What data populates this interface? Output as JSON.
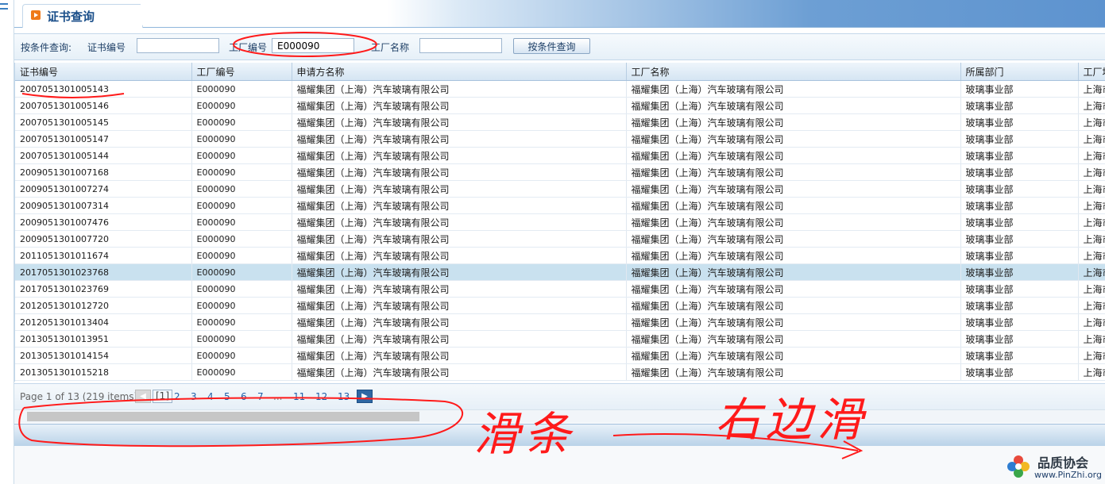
{
  "tab": {
    "title": "证书查询",
    "icon": "play-icon"
  },
  "search": {
    "label": "按条件查询:",
    "cert_no_label": "证书编号",
    "cert_no_value": "",
    "factory_no_label": "工厂编号",
    "factory_no_value": "E000090",
    "factory_name_label": "工厂名称",
    "factory_name_value": "",
    "button_label": "按条件查询"
  },
  "grid": {
    "columns": [
      "证书编号",
      "工厂编号",
      "申请方名称",
      "工厂名称",
      "所属部门",
      "工厂地"
    ],
    "rows": [
      [
        "2007051301005143",
        "E000090",
        "福耀集团（上海）汽车玻璃有限公司",
        "福耀集团（上海）汽车玻璃有限公司",
        "玻璃事业部",
        "上海市"
      ],
      [
        "2007051301005146",
        "E000090",
        "福耀集团（上海）汽车玻璃有限公司",
        "福耀集团（上海）汽车玻璃有限公司",
        "玻璃事业部",
        "上海市"
      ],
      [
        "2007051301005145",
        "E000090",
        "福耀集团（上海）汽车玻璃有限公司",
        "福耀集团（上海）汽车玻璃有限公司",
        "玻璃事业部",
        "上海市"
      ],
      [
        "2007051301005147",
        "E000090",
        "福耀集团（上海）汽车玻璃有限公司",
        "福耀集团（上海）汽车玻璃有限公司",
        "玻璃事业部",
        "上海市"
      ],
      [
        "2007051301005144",
        "E000090",
        "福耀集团（上海）汽车玻璃有限公司",
        "福耀集团（上海）汽车玻璃有限公司",
        "玻璃事业部",
        "上海市"
      ],
      [
        "2009051301007168",
        "E000090",
        "福耀集团（上海）汽车玻璃有限公司",
        "福耀集团（上海）汽车玻璃有限公司",
        "玻璃事业部",
        "上海市"
      ],
      [
        "2009051301007274",
        "E000090",
        "福耀集团（上海）汽车玻璃有限公司",
        "福耀集团（上海）汽车玻璃有限公司",
        "玻璃事业部",
        "上海市"
      ],
      [
        "2009051301007314",
        "E000090",
        "福耀集团（上海）汽车玻璃有限公司",
        "福耀集团（上海）汽车玻璃有限公司",
        "玻璃事业部",
        "上海市"
      ],
      [
        "2009051301007476",
        "E000090",
        "福耀集团（上海）汽车玻璃有限公司",
        "福耀集团（上海）汽车玻璃有限公司",
        "玻璃事业部",
        "上海市"
      ],
      [
        "2009051301007720",
        "E000090",
        "福耀集团（上海）汽车玻璃有限公司",
        "福耀集团（上海）汽车玻璃有限公司",
        "玻璃事业部",
        "上海市"
      ],
      [
        "2011051301011674",
        "E000090",
        "福耀集团（上海）汽车玻璃有限公司",
        "福耀集团（上海）汽车玻璃有限公司",
        "玻璃事业部",
        "上海市"
      ],
      [
        "2017051301023768",
        "E000090",
        "福耀集团（上海）汽车玻璃有限公司",
        "福耀集团（上海）汽车玻璃有限公司",
        "玻璃事业部",
        "上海市"
      ],
      [
        "2017051301023769",
        "E000090",
        "福耀集团（上海）汽车玻璃有限公司",
        "福耀集团（上海）汽车玻璃有限公司",
        "玻璃事业部",
        "上海市"
      ],
      [
        "2012051301012720",
        "E000090",
        "福耀集团（上海）汽车玻璃有限公司",
        "福耀集团（上海）汽车玻璃有限公司",
        "玻璃事业部",
        "上海市"
      ],
      [
        "2012051301013404",
        "E000090",
        "福耀集团（上海）汽车玻璃有限公司",
        "福耀集团（上海）汽车玻璃有限公司",
        "玻璃事业部",
        "上海市"
      ],
      [
        "2013051301013951",
        "E000090",
        "福耀集团（上海）汽车玻璃有限公司",
        "福耀集团（上海）汽车玻璃有限公司",
        "玻璃事业部",
        "上海市"
      ],
      [
        "2013051301014154",
        "E000090",
        "福耀集团（上海）汽车玻璃有限公司",
        "福耀集团（上海）汽车玻璃有限公司",
        "玻璃事业部",
        "上海市"
      ],
      [
        "2013051301015218",
        "E000090",
        "福耀集团（上海）汽车玻璃有限公司",
        "福耀集团（上海）汽车玻璃有限公司",
        "玻璃事业部",
        "上海市"
      ]
    ],
    "selected_row_index": 11
  },
  "pager": {
    "info": "Page 1 of 13 (219 items)",
    "prev_icon": "chevron-left-icon",
    "pages": [
      "[1]",
      "2",
      "3",
      "4",
      "5",
      "6",
      "7",
      "...",
      "11",
      "12",
      "13"
    ],
    "next_icon": "chevron-right-icon"
  },
  "annotations": {
    "color": "#ff1a1a",
    "scrollbar_note": "滑条",
    "direction_note": "右边滑"
  },
  "watermark": {
    "title": "品质协会",
    "url": "www.PinZhi.org"
  },
  "colors": {
    "selected_row": "#c9e1ef",
    "header_blue": "#5d93cf",
    "accent_orange": "#ef7a1a"
  }
}
